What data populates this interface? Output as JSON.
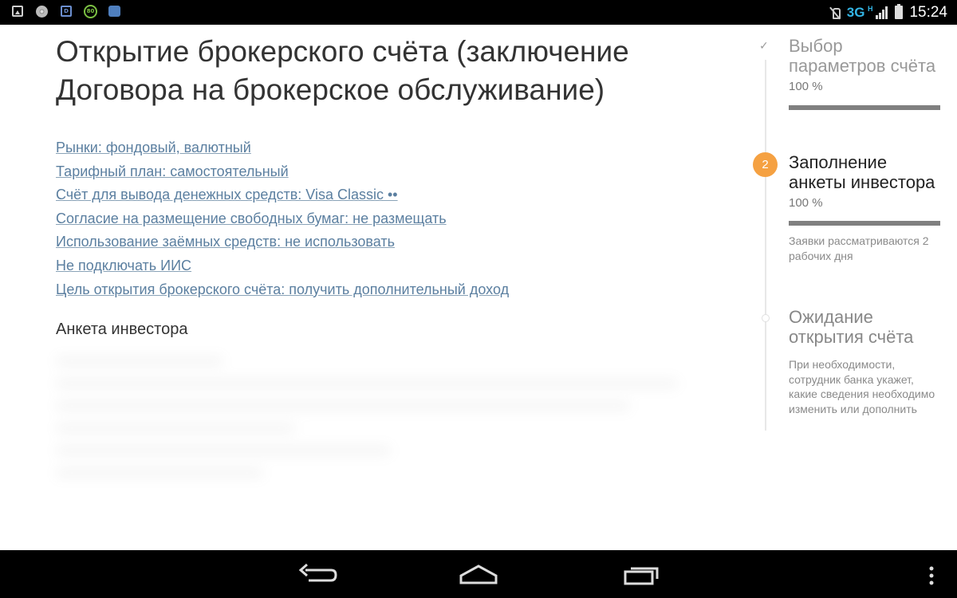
{
  "status_bar": {
    "network": "3G",
    "network_sub": "H",
    "time": "15:24",
    "notification_icons": [
      "image-icon",
      "chrome-icon",
      "app-icon",
      "speed-80-icon",
      "messages-icon"
    ],
    "sb_dm_label": "D",
    "sb_80_label": "80"
  },
  "page": {
    "title": "Открытие брокерского счёта (заключение Договора на брокерское обслуживание)"
  },
  "params": [
    "Рынки: фондовый, валютный",
    "Тарифный план: самостоятельный",
    "Счёт для вывода денежных средств: Visa Classic ••",
    "Согласие на размещение свободных бумаг: не размещать",
    "Использование заёмных средств: не использовать",
    "Не подключать ИИС",
    "Цель открытия брокерского счёта: получить дополнительный доход"
  ],
  "section": {
    "title": "Анкета инвестора"
  },
  "steps": [
    {
      "marker": "✓",
      "title": "Выбор параметров счёта",
      "percent": "100 %",
      "progress": 1.0
    },
    {
      "marker": "2",
      "title": "Заполнение анкеты инвестора",
      "percent": "100 %",
      "progress": 1.0,
      "note": "Заявки рассматриваются 2 рабочих дня"
    },
    {
      "title": "Ожидание открытия счёта",
      "note": "При необходимости, сотрудник банка укажет, какие сведения необходимо изменить или дополнить"
    }
  ],
  "colors": {
    "accent": "#f5a142",
    "link": "#5b7fa0",
    "progress": "#808080"
  }
}
